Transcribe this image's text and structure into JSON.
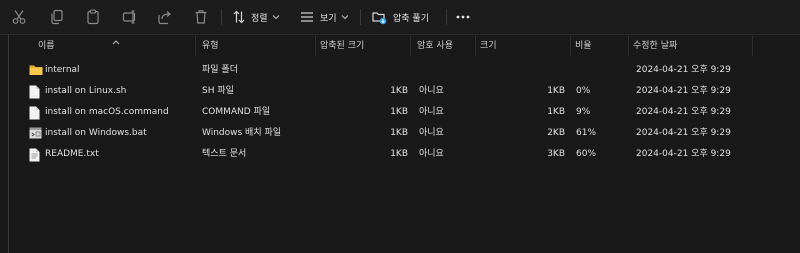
{
  "toolbar": {
    "sort_label": "정렬",
    "view_label": "보기",
    "extract_label": "압축 풀기"
  },
  "columns": {
    "name": "이름",
    "type": "유형",
    "packed": "압축된 크기",
    "protected": "암호 사용",
    "size": "크기",
    "ratio": "비율",
    "modified": "수정한 날짜"
  },
  "files": [
    {
      "name": "internal",
      "type": "파일 폴더",
      "packed": "",
      "protected": "",
      "size": "",
      "ratio": "",
      "modified": "2024-04-21 오후 9:29",
      "icon": "folder-icon"
    },
    {
      "name": "install on Linux.sh",
      "type": "SH 파일",
      "packed": "1KB",
      "protected": "아니요",
      "size": "1KB",
      "ratio": "0%",
      "modified": "2024-04-21 오후 9:29",
      "icon": "file-icon"
    },
    {
      "name": "install on macOS.command",
      "type": "COMMAND 파일",
      "packed": "1KB",
      "protected": "아니요",
      "size": "1KB",
      "ratio": "9%",
      "modified": "2024-04-21 오후 9:29",
      "icon": "file-icon"
    },
    {
      "name": "install on Windows.bat",
      "type": "Windows 배치 파일",
      "packed": "1KB",
      "protected": "아니요",
      "size": "2KB",
      "ratio": "61%",
      "modified": "2024-04-21 오후 9:29",
      "icon": "batch-file-icon"
    },
    {
      "name": "README.txt",
      "type": "텍스트 문서",
      "packed": "1KB",
      "protected": "아니요",
      "size": "3KB",
      "ratio": "60%",
      "modified": "2024-04-21 오후 9:29",
      "icon": "text-file-icon"
    }
  ]
}
